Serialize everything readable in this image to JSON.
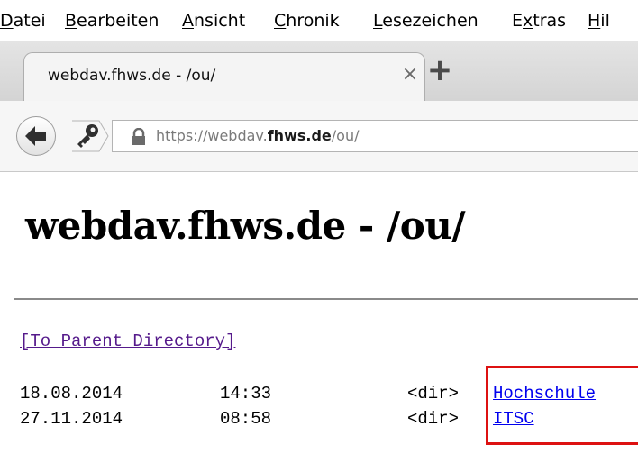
{
  "menu": {
    "items": [
      {
        "pre": "",
        "u": "D",
        "post": "atei"
      },
      {
        "pre": "",
        "u": "B",
        "post": "earbeiten"
      },
      {
        "pre": "",
        "u": "A",
        "post": "nsicht"
      },
      {
        "pre": "",
        "u": "C",
        "post": "hronik"
      },
      {
        "pre": "",
        "u": "L",
        "post": "esezeichen"
      },
      {
        "pre": "E",
        "u": "x",
        "post": "tras"
      },
      {
        "pre": "",
        "u": "H",
        "post": "il"
      }
    ]
  },
  "tab": {
    "title": "webdav.fhws.de - /ou/",
    "close_glyph": "×",
    "new_tab_glyph": "+"
  },
  "navbar": {
    "url_prefix": "https://webdav.",
    "url_domain": "fhws.de",
    "url_path": "/ou/"
  },
  "page": {
    "title": "webdav.fhws.de - /ou/",
    "parent_link": "[To Parent Directory]",
    "entries": [
      {
        "date": "18.08.2014",
        "time": "14:33",
        "type": "<dir>",
        "name": "Hochschule"
      },
      {
        "date": "27.11.2014",
        "time": "08:58",
        "type": "<dir>",
        "name": "ITSC"
      }
    ]
  },
  "colors": {
    "highlight": "#dd1111",
    "link": "#0000ee",
    "visited_link": "#551a8b"
  }
}
